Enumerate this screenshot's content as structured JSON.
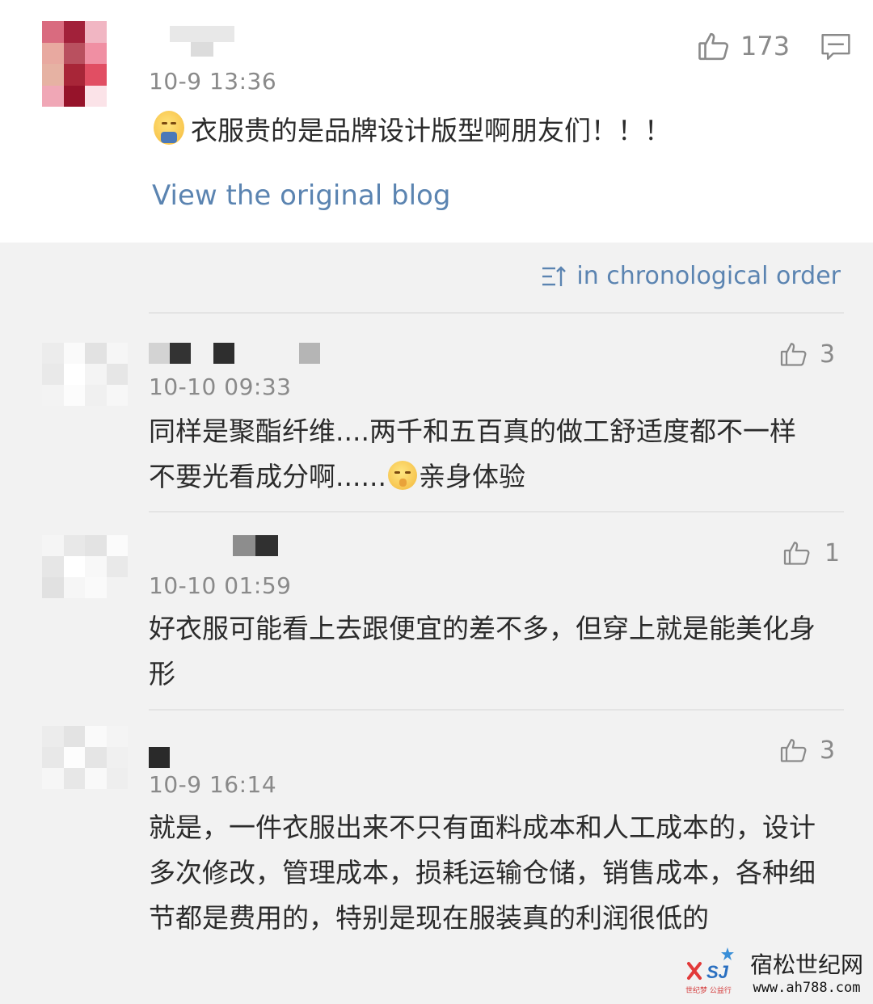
{
  "post": {
    "time": "10-9 13:36",
    "likes": "173",
    "content": "衣服贵的是品牌设计版型啊朋友们！！！",
    "view_original": "View the original blog"
  },
  "sort": {
    "label": "in chronological order"
  },
  "comments": [
    {
      "time": "10-10 09:33",
      "likes": "3",
      "text_a": "同样是聚酯纤维....两千和五百真的做工舒适度都不一样 不要光看成分啊......",
      "text_b": "亲身体验"
    },
    {
      "time": "10-10 01:59",
      "likes": "1",
      "text": "好衣服可能看上去跟便宜的差不多，但穿上就是能美化身形"
    },
    {
      "time": "10-9 16:14",
      "likes": "3",
      "text": "就是，一件衣服出来不只有面料成本和人工成本的，设计多次修改，管理成本，损耗运输仓储，销售成本，各种细节都是费用的，特别是现在服装真的利润很低的"
    }
  ],
  "watermark": {
    "title": "宿松世纪网",
    "url": "www.ah788.com",
    "logo_text": "SJ",
    "logo_sub": "世纪梦 公益行"
  },
  "icons": {
    "like": "thumbs-up-icon",
    "comment": "comment-icon",
    "sort": "sort-order-icon",
    "emoji_post": "sweat-smile-emoji-icon",
    "emoji_comment": "shush-emoji-icon"
  },
  "colors": {
    "link": "#5b84b1",
    "meta": "#8a8a8a",
    "text": "#2b2b2b",
    "background": "#f2f2f2"
  }
}
